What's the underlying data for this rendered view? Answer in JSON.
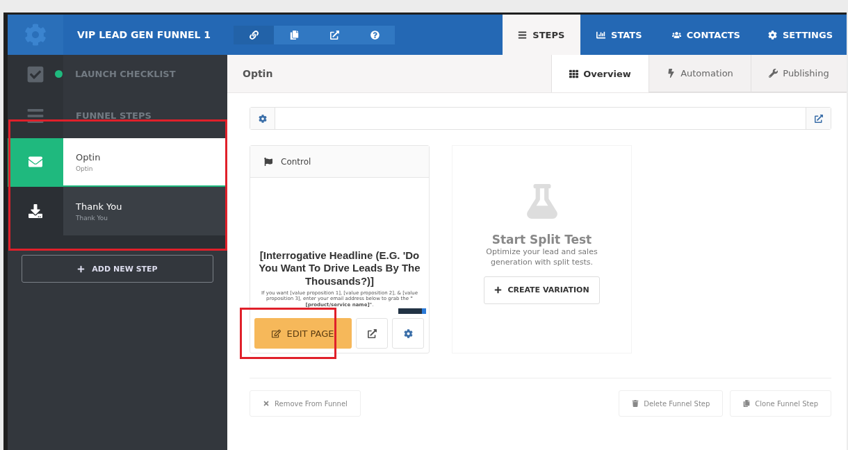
{
  "header": {
    "title": "VIP LEAD GEN FUNNEL 1",
    "tools": [
      {
        "kind": "link",
        "selected": true
      },
      {
        "kind": "copy",
        "selected": false
      },
      {
        "kind": "external",
        "selected": false
      },
      {
        "kind": "help",
        "selected": false
      }
    ],
    "tabs": [
      {
        "kind": "steps",
        "label": "STEPS",
        "selected": true
      },
      {
        "kind": "stats",
        "label": "STATS",
        "selected": false
      },
      {
        "kind": "contacts",
        "label": "CONTACTS",
        "selected": false
      },
      {
        "kind": "settings",
        "label": "SETTINGS",
        "selected": false
      }
    ]
  },
  "sidebar": {
    "checklist": {
      "label": "LAUNCH CHECKLIST",
      "color": "#1fb97e"
    },
    "section": "FUNNEL STEPS",
    "steps": [
      {
        "kind": "optin",
        "name": "Optin",
        "subtitle": "Optin",
        "selected": true
      },
      {
        "kind": "download",
        "name": "Thank You",
        "subtitle": "Thank You",
        "selected": false
      }
    ],
    "add_button": "ADD NEW STEP"
  },
  "content": {
    "title": "Optin",
    "subtabs": [
      {
        "kind": "overview",
        "label": "Overview",
        "selected": true
      },
      {
        "kind": "automation",
        "label": "Automation",
        "selected": false
      },
      {
        "kind": "publishing",
        "label": "Publishing",
        "selected": false
      }
    ],
    "control": {
      "label": "Control",
      "headline": "[Interrogative Headline (E.G. 'Do You Want To Drive Leads By The Thousands?)]",
      "body": "If you want [value proposition 1], [value proposition 2], & [value proposition 3], enter your email address below to grab the **\"[product/service name]\"**.",
      "edit_button": "EDIT PAGE"
    },
    "split": {
      "title": "Start Split Test",
      "text": "Optimize your lead and sales generation with split tests.",
      "button": "CREATE VARIATION"
    },
    "footer": {
      "remove": "Remove From Funnel",
      "delete": "Delete Funnel Step",
      "clone": "Clone Funnel Step"
    }
  }
}
